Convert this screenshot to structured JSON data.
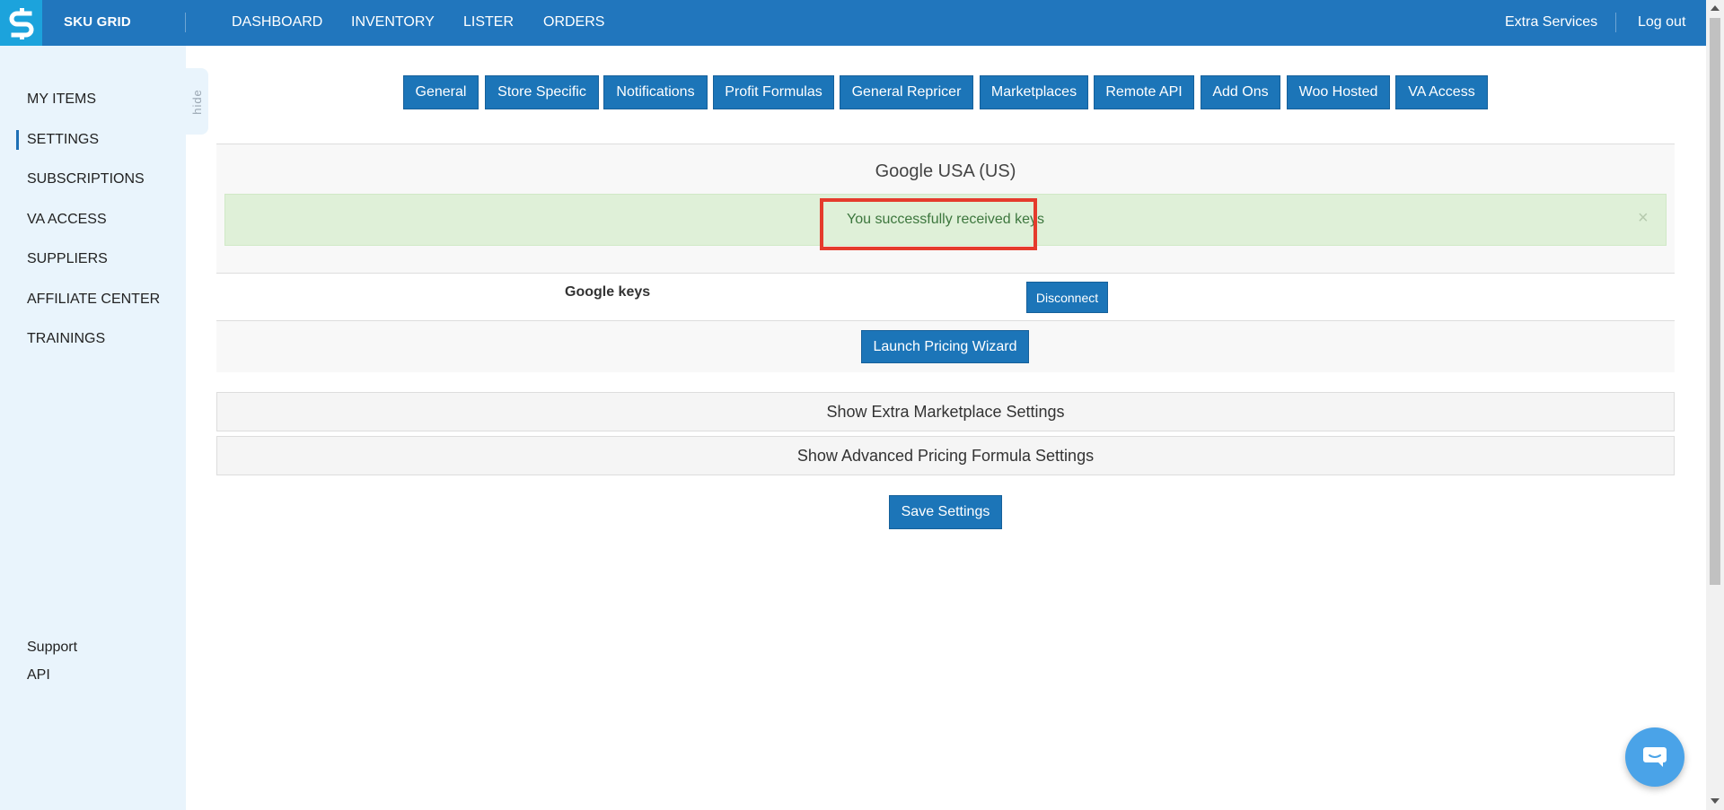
{
  "header": {
    "brand": "SKU GRID",
    "nav": [
      "DASHBOARD",
      "INVENTORY",
      "LISTER",
      "ORDERS"
    ],
    "extra_services": "Extra Services",
    "logout": "Log out"
  },
  "sidebar": {
    "items": [
      "MY ITEMS",
      "SETTINGS",
      "SUBSCRIPTIONS",
      "VA ACCESS",
      "SUPPLIERS",
      "AFFILIATE CENTER",
      "TRAININGS"
    ],
    "active": "SETTINGS",
    "bottom": [
      "Support",
      "API"
    ],
    "hide_label": "hide"
  },
  "tabs": [
    "General",
    "Store Specific",
    "Notifications",
    "Profit Formulas",
    "General Repricer",
    "Marketplaces",
    "Remote API",
    "Add Ons",
    "Woo Hosted",
    "VA Access"
  ],
  "panel": {
    "title": "Google USA (US)",
    "alert": "You successfully received keys",
    "alert_close": "×",
    "keys_label": "Google keys",
    "disconnect": "Disconnect",
    "wizard": "Launch Pricing Wizard"
  },
  "toggles": {
    "extra": "Show Extra Marketplace Settings",
    "advanced": "Show Advanced Pricing Formula Settings"
  },
  "save": "Save Settings",
  "colors": {
    "topbar": "#2176bd",
    "logo_bg": "#1ca3dc",
    "sidebar_bg": "#e9f4fc",
    "button": "#1c75b8",
    "alert_bg": "#dff0d8",
    "alert_text": "#3c763d",
    "highlight": "#e53b2c"
  },
  "icons": {
    "logo": "dollar-s-logo-icon",
    "chat": "chat-bubble-icon",
    "close": "close-icon"
  }
}
